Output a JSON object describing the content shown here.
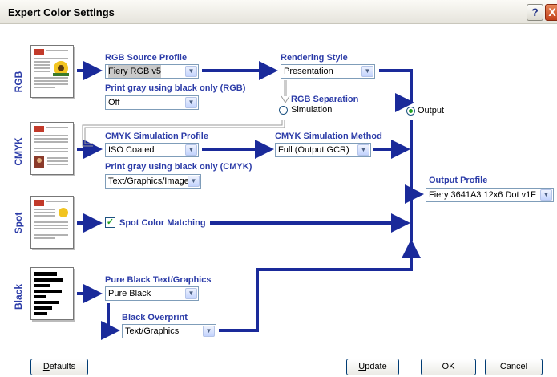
{
  "window": {
    "title": "Expert Color Settings",
    "help": "?",
    "close": "X"
  },
  "rows": {
    "rgb": "RGB",
    "cmyk": "CMYK",
    "spot": "Spot",
    "black": "Black"
  },
  "rgb_source": {
    "label": "RGB Source Profile",
    "value": "Fiery RGB v5"
  },
  "print_gray_rgb": {
    "label": "Print gray using black only (RGB)",
    "value": "Off"
  },
  "rendering": {
    "label": "Rendering Style",
    "value": "Presentation"
  },
  "rgb_separation": {
    "label": "RGB Separation",
    "option_simulation": "Simulation",
    "option_output": "Output",
    "selected": "Output"
  },
  "cmyk_sim_profile": {
    "label": "CMYK Simulation Profile",
    "value": "ISO Coated"
  },
  "cmyk_sim_method": {
    "label": "CMYK Simulation Method",
    "value": "Full (Output GCR)"
  },
  "print_gray_cmyk": {
    "label": "Print gray using black only (CMYK)",
    "value": "Text/Graphics/Image"
  },
  "spot": {
    "label": "Spot Color Matching",
    "checked": true
  },
  "pure_black": {
    "label": "Pure Black Text/Graphics",
    "value": "Pure Black"
  },
  "black_overprint": {
    "label": "Black Overprint",
    "value": "Text/Graphics"
  },
  "output_profile": {
    "label": "Output Profile",
    "value": "Fiery 3641A3 12x6 Dot v1F"
  },
  "buttons": {
    "defaults": {
      "mnemonic": "D",
      "rest": "efaults"
    },
    "update": {
      "mnemonic": "U",
      "rest": "pdate"
    },
    "ok": "OK",
    "cancel": "Cancel"
  },
  "colors": {
    "accent": "#2c3ca8",
    "wire": "#1a2a9a",
    "radio_dot": "#21a121"
  }
}
